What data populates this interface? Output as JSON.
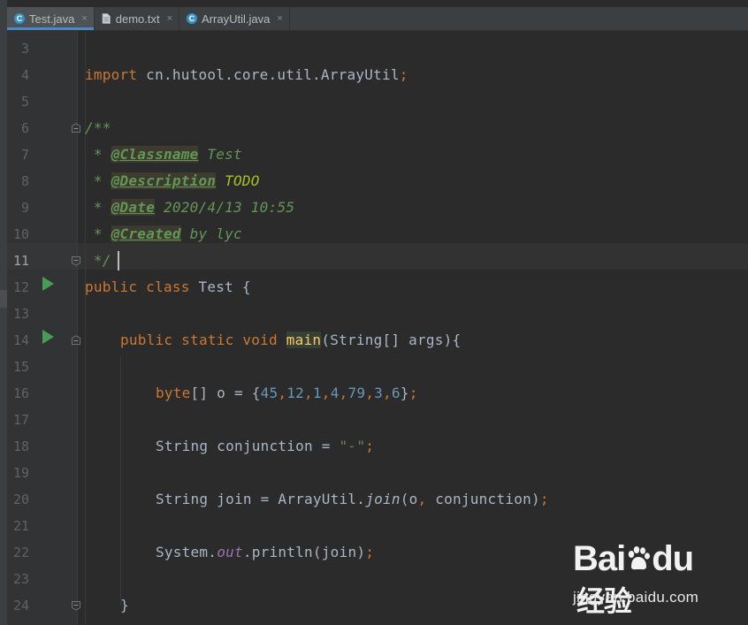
{
  "tabs": [
    {
      "label": "Test.java",
      "icon": "java-class-icon",
      "active": true
    },
    {
      "label": "demo.txt",
      "icon": "text-file-icon",
      "active": false
    },
    {
      "label": "ArrayUtil.java",
      "icon": "java-class-icon",
      "active": false
    }
  ],
  "tab_close_glyph": "×",
  "class_icon_letter": "C",
  "line_numbers": [
    "3",
    "4",
    "5",
    "6",
    "7",
    "8",
    "9",
    "10",
    "11",
    "12",
    "13",
    "14",
    "15",
    "16",
    "17",
    "18",
    "19",
    "20",
    "21",
    "22",
    "23",
    "24"
  ],
  "code": {
    "l4": {
      "kw": "import",
      "pkg": " cn.hutool.core.util.ArrayUtil",
      "semi": ";"
    },
    "l6": "/**",
    "l7": {
      "star": " * ",
      "tag": "@Classname",
      "text": " Test"
    },
    "l8": {
      "star": " * ",
      "tag": "@Description",
      "text": " TODO"
    },
    "l9": {
      "star": " * ",
      "tag": "@Date",
      "text": " 2020/4/13 10:55"
    },
    "l10": {
      "star": " * ",
      "tag": "@Created",
      "text": " by lyc"
    },
    "l11": " */",
    "l12": {
      "kw": "public class",
      "name": " Test {"
    },
    "l14": {
      "kw": "public static void",
      "method": "main",
      "rest": "(String[] args){"
    },
    "l16": {
      "kw": "byte",
      "pre": "[] o = {",
      "nums": [
        "45",
        "12",
        "1",
        "4",
        "79",
        "3",
        "6"
      ],
      "post": "}",
      "semi": ";"
    },
    "l18": {
      "pre": "String conjunction = ",
      "str": "\"-\"",
      "semi": ";"
    },
    "l20": {
      "pre": "String join = ArrayUtil.",
      "method": "join",
      "post": "(o",
      "comma": ",",
      "post2": " conjunction)",
      "semi": ";"
    },
    "l22": {
      "pre": "System.",
      "field": "out",
      "post": ".println(join)",
      "semi": ";"
    },
    "l24": "}"
  },
  "watermark": {
    "brand": "Bai",
    "brand2": "du",
    "cn": "经验",
    "url": "jingyan.baidu.com"
  },
  "colors": {
    "keyword": "#cc7832",
    "number": "#6897bb",
    "doc": "#629755",
    "string": "#6a8759",
    "field": "#9876aa",
    "method": "#ffc66d",
    "run": "#499c54"
  }
}
